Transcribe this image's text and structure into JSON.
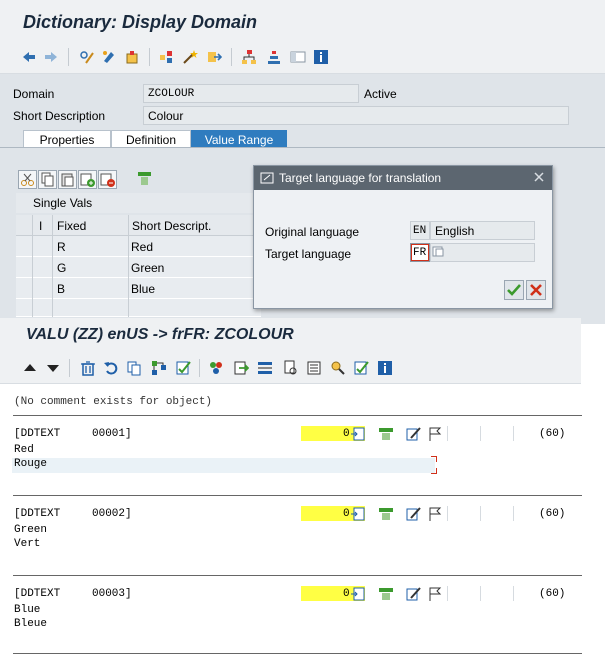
{
  "main_window": {
    "title": "Dictionary: Display Domain",
    "fields": {
      "domain_label": "Domain",
      "domain_value": "ZCOLOUR",
      "status": "Active",
      "short_desc_label": "Short Description",
      "short_desc_value": "Colour"
    },
    "tabs": [
      {
        "label": "Properties",
        "active": false
      },
      {
        "label": "Definition",
        "active": false
      },
      {
        "label": "Value Range",
        "active": true
      }
    ],
    "single_vals_label": "Single Vals",
    "table": {
      "headers": [
        "I",
        "Fixed",
        "Short Descript."
      ],
      "rows": [
        {
          "fixed": "R",
          "desc": "Red"
        },
        {
          "fixed": "G",
          "desc": "Green"
        },
        {
          "fixed": "B",
          "desc": "Blue"
        }
      ]
    }
  },
  "popup": {
    "title": "Target language for translation",
    "original_label": "Original language",
    "original_code": "EN",
    "original_name": "English",
    "target_label": "Target language",
    "target_code": "FR",
    "target_name": ""
  },
  "translation_window": {
    "title": "VALU (ZZ) enUS -> frFR: ZCOLOUR",
    "comment": "(No comment exists for object)",
    "entries": [
      {
        "tag": "[DDTEXT",
        "num": "00001]",
        "count": "0",
        "length": "(60)",
        "source": "Red",
        "target": "Rouge"
      },
      {
        "tag": "[DDTEXT",
        "num": "00002]",
        "count": "0",
        "length": "(60)",
        "source": "Green",
        "target": "Vert"
      },
      {
        "tag": "[DDTEXT",
        "num": "00003]",
        "count": "0",
        "length": "(60)",
        "source": "Blue",
        "target": "Bleue"
      }
    ]
  },
  "colors": {
    "accent_tab": "#2f7cbf",
    "highlight_yellow": "#ffff44",
    "popup_header": "#5c6670",
    "confirm_green": "#3c9a2e",
    "cancel_red": "#d0301a"
  }
}
